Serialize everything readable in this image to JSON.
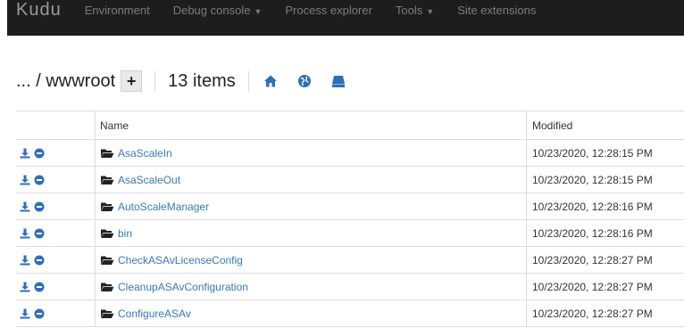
{
  "navbar": {
    "brand": "Kudu",
    "items": [
      {
        "label": "Environment",
        "dropdown": false
      },
      {
        "label": "Debug console",
        "dropdown": true
      },
      {
        "label": "Process explorer",
        "dropdown": false
      },
      {
        "label": "Tools",
        "dropdown": true
      },
      {
        "label": "Site extensions",
        "dropdown": false
      }
    ]
  },
  "path": {
    "text": "... / wwwroot",
    "add_label": "+",
    "count": "13 items"
  },
  "icons": {
    "home": "home-icon",
    "globe": "globe-icon",
    "drive": "drive-icon",
    "download": "download-icon",
    "remove": "minus-circle-icon",
    "folder": "folder-open-icon"
  },
  "colors": {
    "navbar_bg": "#1d1d1d",
    "link": "#3a78b5",
    "icon_blue": "#2f6fb4"
  },
  "table": {
    "headers": {
      "name": "Name",
      "modified": "Modified"
    },
    "rows": [
      {
        "name": "AsaScaleIn",
        "modified": "10/23/2020, 12:28:15 PM"
      },
      {
        "name": "AsaScaleOut",
        "modified": "10/23/2020, 12:28:15 PM"
      },
      {
        "name": "AutoScaleManager",
        "modified": "10/23/2020, 12:28:16 PM"
      },
      {
        "name": "bin",
        "modified": "10/23/2020, 12:28:16 PM"
      },
      {
        "name": "CheckASAvLicenseConfig",
        "modified": "10/23/2020, 12:28:27 PM"
      },
      {
        "name": "CleanupASAvConfiguration",
        "modified": "10/23/2020, 12:28:27 PM"
      },
      {
        "name": "ConfigureASAv",
        "modified": "10/23/2020, 12:28:27 PM"
      }
    ]
  }
}
